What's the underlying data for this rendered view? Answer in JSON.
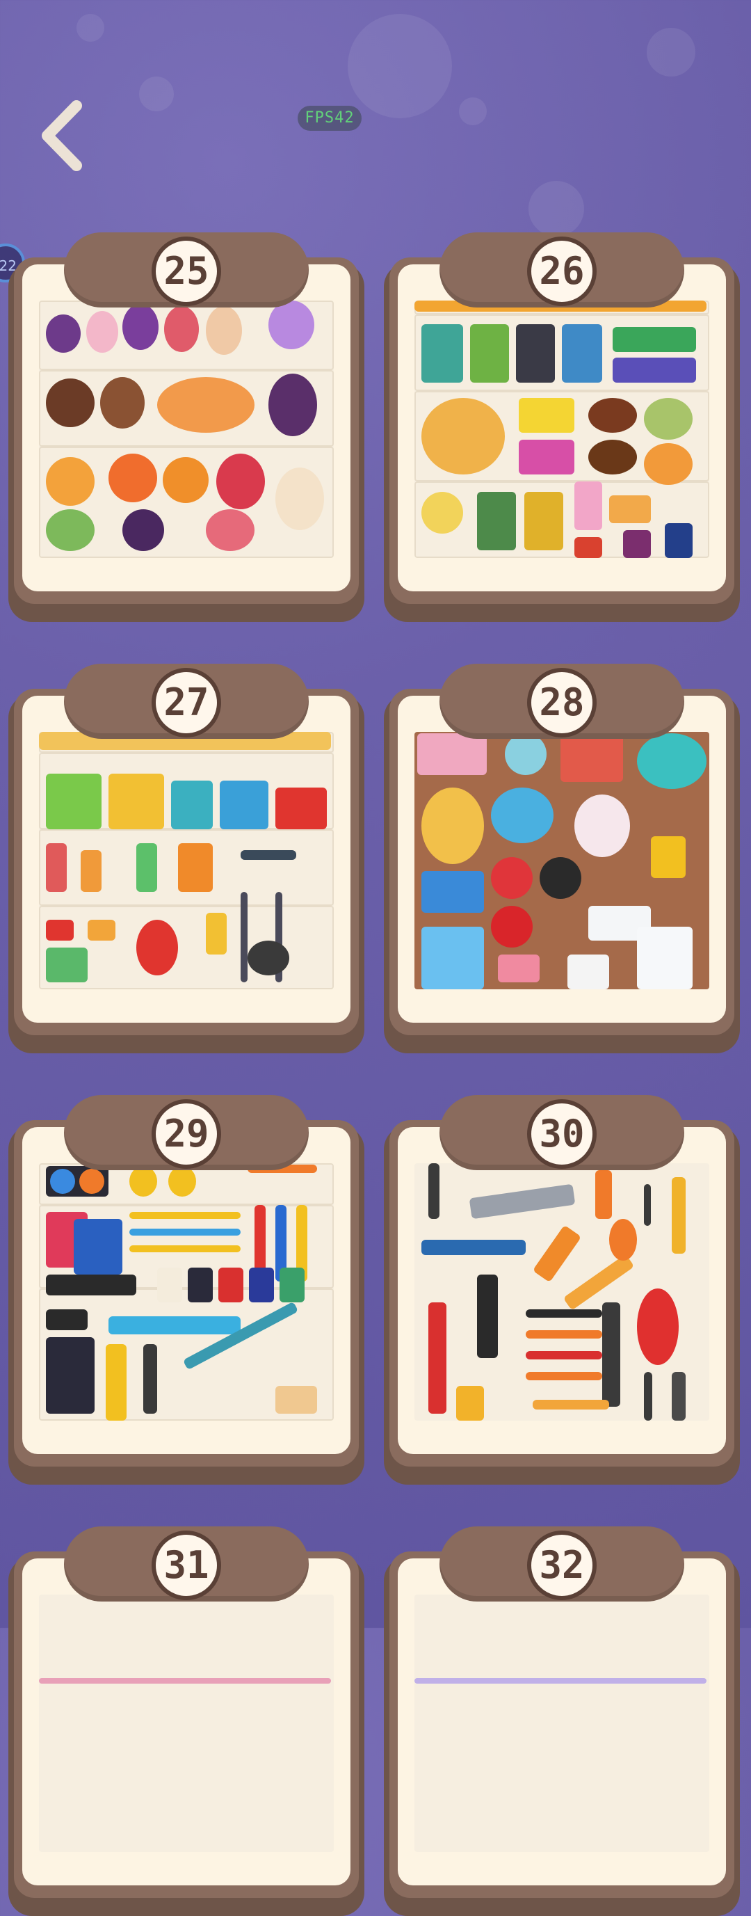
{
  "hud": {
    "fps_label": "FPS42",
    "side_badge": "22"
  },
  "levels": [
    {
      "number": "25",
      "theme_icon": "desserts-fruit-icon"
    },
    {
      "number": "26",
      "theme_icon": "snacks-icon"
    },
    {
      "number": "27",
      "theme_icon": "cleaning-supplies-icon"
    },
    {
      "number": "28",
      "theme_icon": "appliances-icon"
    },
    {
      "number": "29",
      "theme_icon": "stationery-icon"
    },
    {
      "number": "30",
      "theme_icon": "tools-icon"
    },
    {
      "number": "31",
      "theme_icon": "level-icon"
    },
    {
      "number": "32",
      "theme_icon": "level-icon"
    }
  ],
  "colors": {
    "background": "#6b60aa",
    "card_frame": "#8a6c5e",
    "card_paper": "#fdf4e3",
    "number_text": "#5a4036",
    "fps_text": "#62d17a"
  }
}
